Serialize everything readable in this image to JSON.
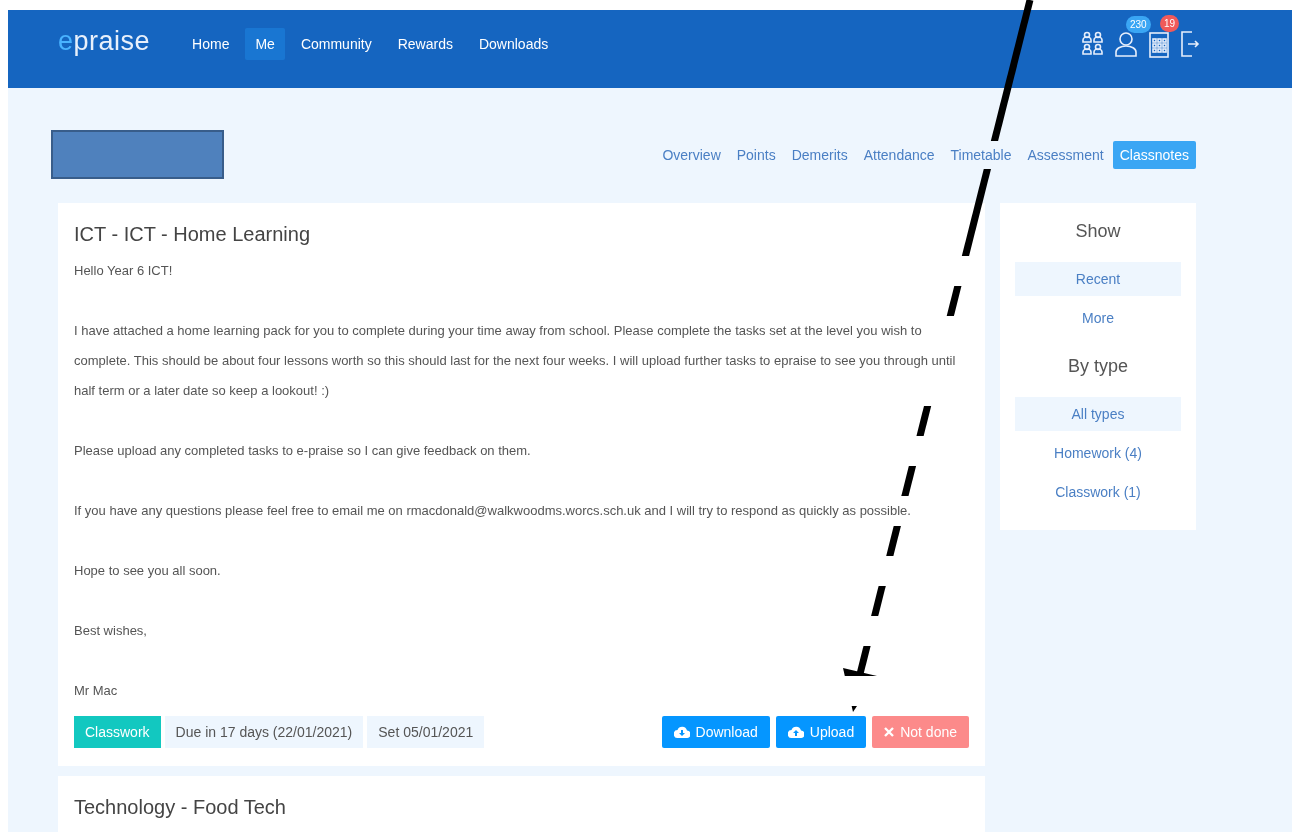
{
  "brand": {
    "accent": "e",
    "rest": "praise"
  },
  "nav": [
    {
      "label": "Home",
      "selected": false
    },
    {
      "label": "Me",
      "selected": true
    },
    {
      "label": "Community",
      "selected": false
    },
    {
      "label": "Rewards",
      "selected": false
    },
    {
      "label": "Downloads",
      "selected": false
    }
  ],
  "header_icons": [
    {
      "kind": "group"
    },
    {
      "kind": "person",
      "badge": "230",
      "color": "#3aa6f4"
    },
    {
      "kind": "calendar",
      "badge": "19",
      "color": "#f05a5a"
    },
    {
      "kind": "logout"
    }
  ],
  "tabs": [
    {
      "label": "Overview",
      "selected": false
    },
    {
      "label": "Points",
      "selected": false
    },
    {
      "label": "Demerits",
      "selected": false
    },
    {
      "label": "Attendance",
      "selected": false
    },
    {
      "label": "Timetable",
      "selected": false
    },
    {
      "label": "Assessment",
      "selected": false
    },
    {
      "label": "Classnotes",
      "selected": true
    }
  ],
  "note": {
    "title": "ICT - ICT - Home Learning",
    "paragraphs": [
      "Hello Year 6 ICT!",
      "I have attached a home learning pack for you to complete during your time away from school. Please complete the tasks set at the level you wish to complete. This should be about four lessons worth so this should last for the next four weeks. I will upload further tasks to epraise to see you through until half term or a later date so keep a lookout! :)",
      "Please upload any completed tasks to e-praise so I can give feedback on them.",
      "If you have any questions please feel free to email me on rmacdonald@walkwoodms.worcs.sch.uk and I will try to respond as quickly as possible.",
      "Hope to see you all soon.",
      "Best wishes,",
      "Mr Mac"
    ],
    "tags": [
      {
        "label": "Classwork",
        "kind": "type"
      },
      {
        "label": "Due in 17 days (22/01/2021)",
        "kind": "info"
      },
      {
        "label": "Set 05/01/2021",
        "kind": "info"
      }
    ],
    "actions": [
      {
        "label": "Download",
        "kind": "download"
      },
      {
        "label": "Upload",
        "kind": "upload"
      },
      {
        "label": "Not done",
        "kind": "notdone"
      }
    ]
  },
  "next_note": {
    "title": "Technology - Food Tech"
  },
  "filter": {
    "show_heading": "Show",
    "show_items": [
      {
        "label": "Recent",
        "selected": true
      },
      {
        "label": "More",
        "selected": false
      }
    ],
    "type_heading": "By type",
    "type_items": [
      {
        "label": "All types",
        "selected": true
      },
      {
        "label": "Homework (4)",
        "selected": false
      },
      {
        "label": "Classwork (1)",
        "selected": false
      }
    ]
  }
}
